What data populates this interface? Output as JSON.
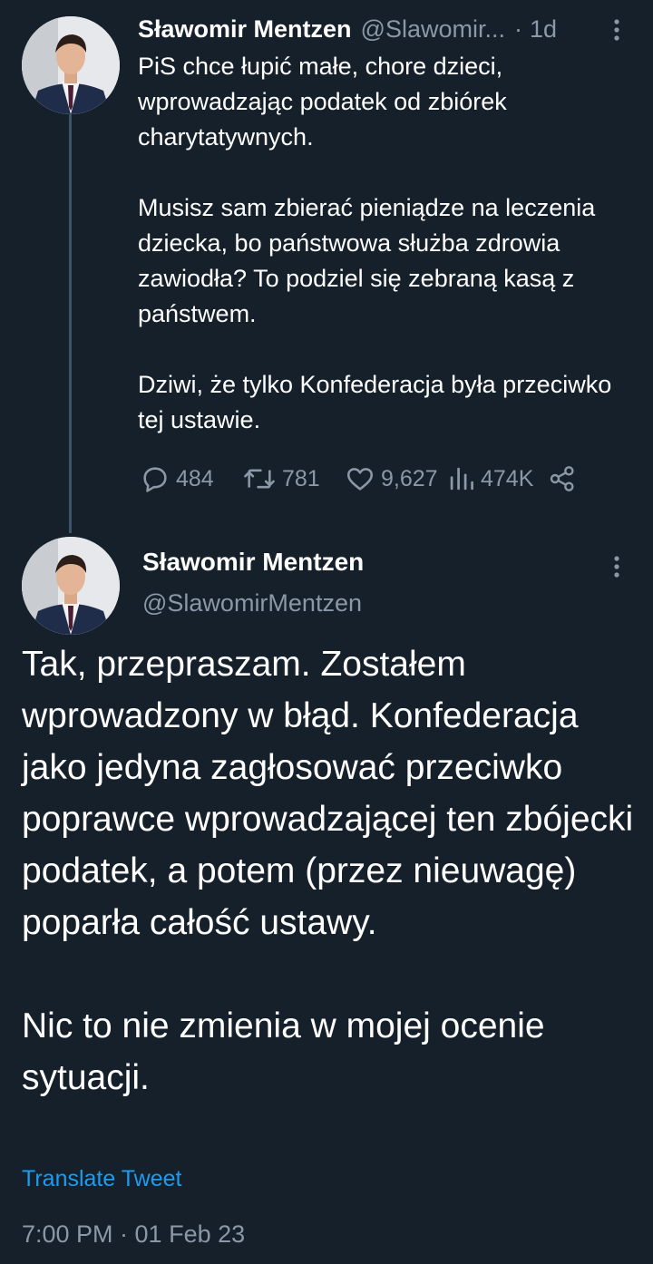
{
  "thread": {
    "parent_tweet": {
      "author_name": "Sławomir Mentzen",
      "author_handle": "@Slawomir...",
      "separator": "·",
      "time_ago": "1d",
      "text": "PiS chce łupić małe, chore dzieci, wprowadzając podatek od zbiórek charytatywnych.\n\nMusisz sam zbierać pieniądze na leczenia dziecka, bo państwowa służba zdrowia zawiodła? To podziel się zebraną kasą z państwem.\n\nDziwi, że tylko Konfederacja była przeciwko tej ustawie.",
      "actions": {
        "replies": "484",
        "retweets": "781",
        "likes": "9,627",
        "views": "474K"
      },
      "icons": [
        "reply-icon",
        "retweet-icon",
        "like-icon",
        "views-icon",
        "share-icon",
        "more-options-icon"
      ]
    },
    "main_tweet": {
      "author_name": "Sławomir Mentzen",
      "author_handle": "@SlawomirMentzen",
      "text": "Tak, przepraszam. Zostałem wprowadzony w błąd. Konfederacja jako jedyna zagłosować przeciwko poprawce wprowadzającej ten zbójecki podatek, a potem (przez nieuwagę) poparła całość ustawy.\n\nNic to nie zmienia w mojej ocenie sytuacji.",
      "translate_label": "Translate Tweet",
      "timestamp": "7:00 PM · 01 Feb 23"
    }
  },
  "colors": {
    "background": "#15202b",
    "text_primary": "#ffffff",
    "text_secondary": "#8b98a5",
    "link": "#1d9bf0",
    "thread_line": "#3d5466"
  }
}
